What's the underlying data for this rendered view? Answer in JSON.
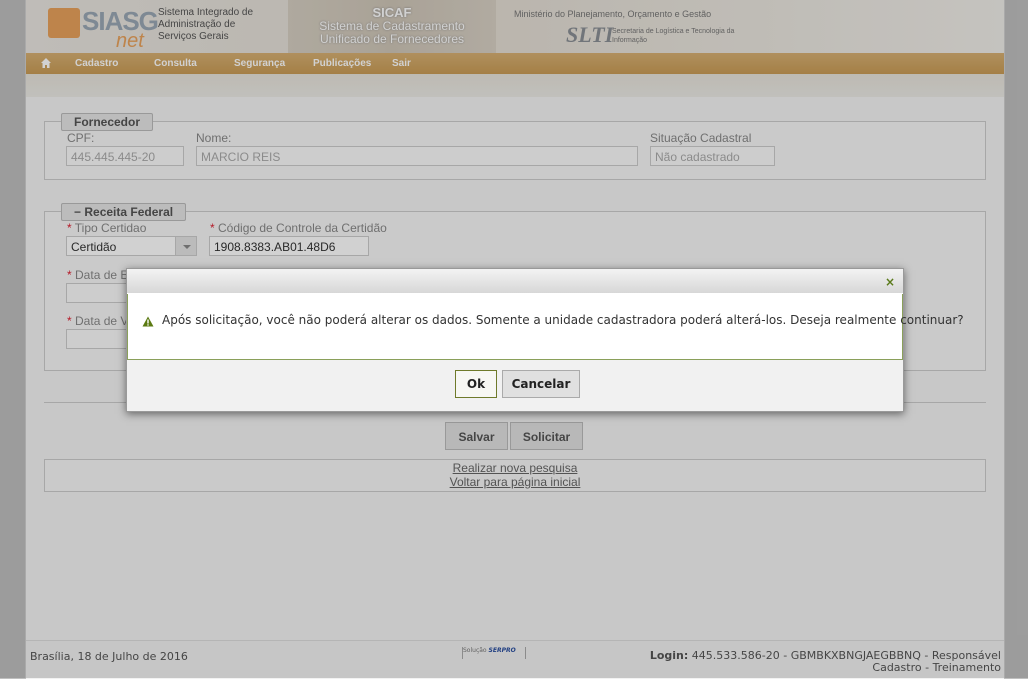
{
  "header": {
    "logo_text": "SIASG",
    "logo_suffix": "net",
    "siasg_subtitle": "Sistema Integrado de Administração de Serviços Gerais",
    "sicaf_title": "SICAF",
    "sicaf_subtitle_1": "Sistema de Cadastramento",
    "sicaf_subtitle_2": "Unificado de Fornecedores",
    "ministry": "Ministério do Planejamento, Orçamento e Gestão",
    "slti_mark": "SLTI",
    "slti_text": "Secretaria de Logística e Tecnologia da Informação"
  },
  "menu": {
    "items": [
      "Cadastro",
      "Consulta",
      "Segurança",
      "Publicações",
      "Sair"
    ]
  },
  "fornecedor": {
    "legend": "Fornecedor",
    "cpf_label": "CPF:",
    "cpf_value": "445.445.445-20",
    "nome_label": "Nome:",
    "nome_value": "MARCIO REIS",
    "situacao_label": "Situação Cadastral",
    "situacao_value": "Não cadastrado"
  },
  "receita": {
    "legend": "Receita Federal",
    "collapse_symbol": "−",
    "tipo_label": "Tipo Certidao",
    "tipo_value": "Certidão",
    "codigo_label": "Código de Controle da Certidão",
    "codigo_value": "1908.8383.AB01.48D6",
    "data_emissao_label": "Data de E",
    "data_validade_label": "Data de V",
    "required_mark": "*"
  },
  "actions": {
    "salvar": "Salvar",
    "solicitar": "Solicitar",
    "nova_pesquisa": "Realizar nova pesquisa",
    "voltar": "Voltar para página inicial"
  },
  "footer": {
    "location_date": "Brasília, 18 de Julho de 2016",
    "solution_text": "Solução",
    "serpro_logo": "SERPRO",
    "login_label": "Login:",
    "login_value": "445.533.586-20 - GBMBKXBNGJAEGBBNQ - Responsável",
    "login_line2": "Cadastro - Treinamento"
  },
  "dialog": {
    "close_symbol": "×",
    "message": "Após solicitação, você não poderá alterar os dados. Somente a unidade cadastradora poderá alterá-los. Deseja realmente continuar?",
    "ok_label": "Ok",
    "cancel_label": "Cancelar"
  },
  "icons": [
    "home-icon",
    "warning-icon",
    "close-icon",
    "chevron-down-icon",
    "collapse-icon"
  ]
}
